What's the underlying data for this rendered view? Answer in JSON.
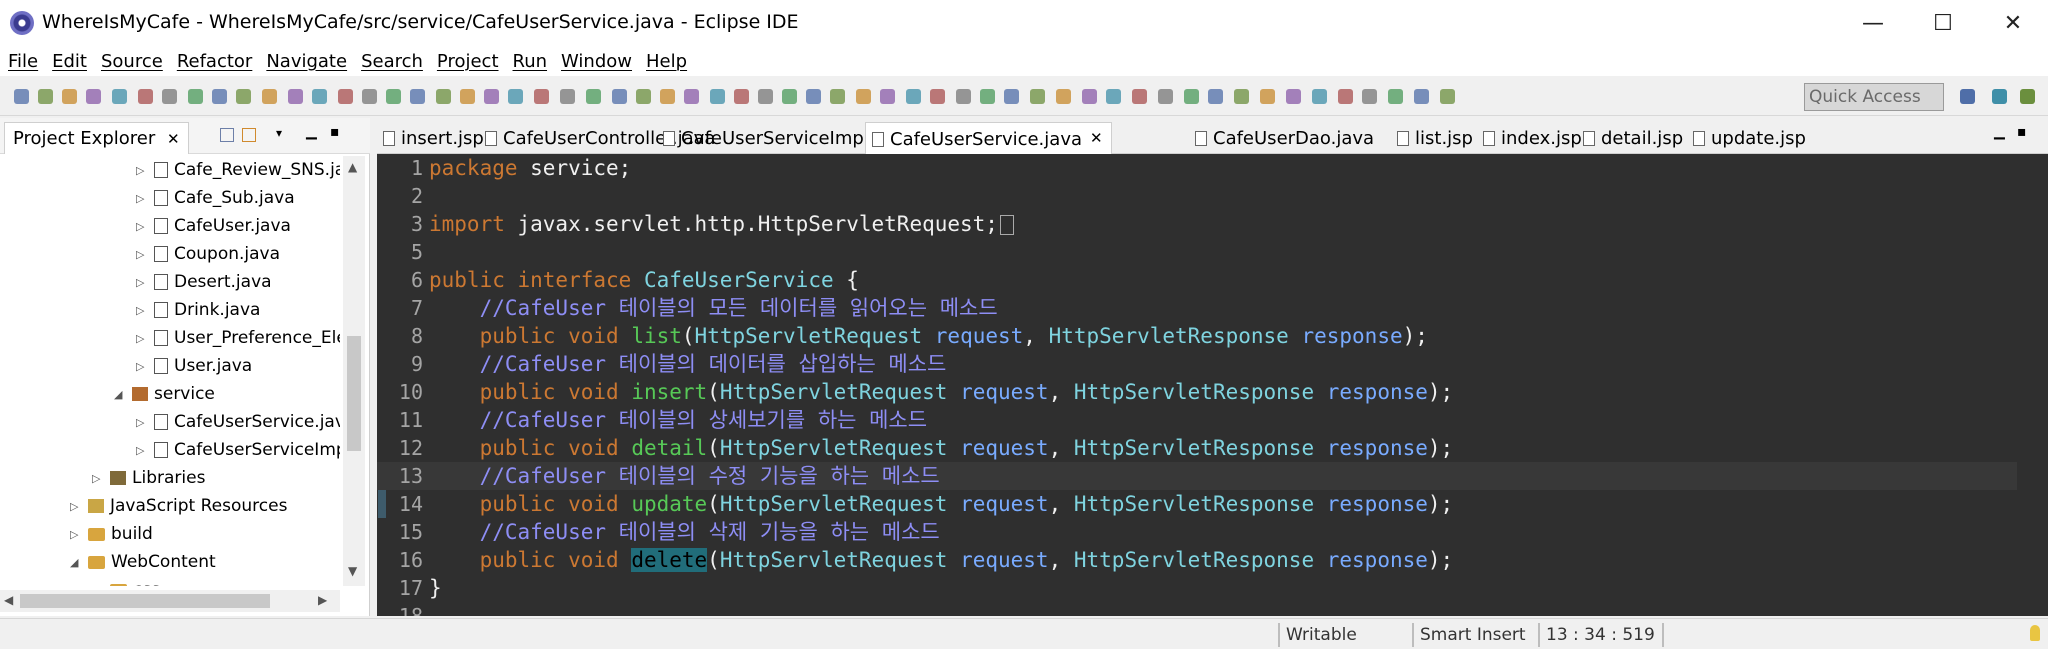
{
  "window": {
    "title": "WhereIsMyCafe - WhereIsMyCafe/src/service/CafeUserService.java - Eclipse IDE",
    "minimize": "—",
    "maximize": "☐",
    "close": "✕"
  },
  "menu": [
    "File",
    "Edit",
    "Source",
    "Refactor",
    "Navigate",
    "Search",
    "Project",
    "Run",
    "Window",
    "Help"
  ],
  "toolbar": {
    "quick_access_placeholder": "Quick Access"
  },
  "explorer": {
    "tab_label": "Project Explorer",
    "tab_close": "✕",
    "items": [
      {
        "label": "Cafe_Review_SNS.java",
        "type": "java",
        "indent": 1,
        "arrow": "▷"
      },
      {
        "label": "Cafe_Sub.java",
        "type": "java",
        "indent": 1,
        "arrow": "▷"
      },
      {
        "label": "CafeUser.java",
        "type": "java",
        "indent": 1,
        "arrow": "▷"
      },
      {
        "label": "Coupon.java",
        "type": "java",
        "indent": 1,
        "arrow": "▷"
      },
      {
        "label": "Desert.java",
        "type": "java",
        "indent": 1,
        "arrow": "▷"
      },
      {
        "label": "Drink.java",
        "type": "java",
        "indent": 1,
        "arrow": "▷"
      },
      {
        "label": "User_Preference_Element.java",
        "type": "java",
        "indent": 1,
        "arrow": "▷"
      },
      {
        "label": "User.java",
        "type": "java",
        "indent": 1,
        "arrow": "▷"
      },
      {
        "label": "service",
        "type": "pkg",
        "indent": 0,
        "arrow": "◢"
      },
      {
        "label": "CafeUserService.java",
        "type": "java",
        "indent": 1,
        "arrow": "▷"
      },
      {
        "label": "CafeUserServiceImpl.java",
        "type": "java",
        "indent": 1,
        "arrow": "▷"
      },
      {
        "label": "Libraries",
        "type": "lib",
        "indent": -1,
        "arrow": "▷"
      },
      {
        "label": "JavaScript Resources",
        "type": "js",
        "indent": -2,
        "arrow": "▷"
      },
      {
        "label": "build",
        "type": "folder",
        "indent": -2,
        "arrow": "▷"
      },
      {
        "label": "WebContent",
        "type": "folder",
        "indent": -2,
        "arrow": "◢"
      },
      {
        "label": "css",
        "type": "folder",
        "indent": -1,
        "arrow": "▷"
      }
    ]
  },
  "editor": {
    "tabs": [
      {
        "label": "insert.jsp",
        "active": false
      },
      {
        "label": "CafeUserController.java",
        "active": false
      },
      {
        "label": "CafeUserServiceImpl.java",
        "active": false
      },
      {
        "label": "CafeUserService.java",
        "active": true,
        "close": "✕"
      },
      {
        "label": "CafeUserDao.java",
        "active": false
      },
      {
        "label": "list.jsp",
        "active": false
      },
      {
        "label": "index.jsp",
        "active": false
      },
      {
        "label": "detail.jsp",
        "active": false
      },
      {
        "label": "update.jsp",
        "active": false
      }
    ],
    "lines": [
      {
        "n": "1",
        "tokens": [
          [
            "kw",
            "package"
          ],
          [
            "plain",
            " service;"
          ]
        ]
      },
      {
        "n": "2",
        "tokens": []
      },
      {
        "n": "3",
        "tokens": [
          [
            "kw",
            "import"
          ],
          [
            "plain",
            " javax.servlet.http.HttpServletRequest;"
          ]
        ],
        "fold": true
      },
      {
        "n": "5",
        "tokens": []
      },
      {
        "n": "6",
        "tokens": [
          [
            "kw",
            "public interface"
          ],
          [
            "plain",
            " "
          ],
          [
            "cls",
            "CafeUserService"
          ],
          [
            "plain",
            " {"
          ]
        ]
      },
      {
        "n": "7",
        "tokens": [
          [
            "plain",
            "    "
          ],
          [
            "cmt",
            "//CafeUser 테이블의 모든 데이터를 읽어오는 메소드"
          ]
        ]
      },
      {
        "n": "8",
        "tokens": [
          [
            "plain",
            "    "
          ],
          [
            "kw",
            "public void"
          ],
          [
            "plain",
            " "
          ],
          [
            "meth",
            "list"
          ],
          [
            "plain",
            "("
          ],
          [
            "cls",
            "HttpServletRequest"
          ],
          [
            "plain",
            " "
          ],
          [
            "var",
            "request"
          ],
          [
            "plain",
            ", "
          ],
          [
            "cls",
            "HttpServletResponse"
          ],
          [
            "plain",
            " "
          ],
          [
            "var",
            "response"
          ],
          [
            "plain",
            ");"
          ]
        ]
      },
      {
        "n": "9",
        "tokens": [
          [
            "plain",
            "    "
          ],
          [
            "cmt",
            "//CafeUser 테이블의 데이터를 삽입하는 메소드"
          ]
        ]
      },
      {
        "n": "10",
        "tokens": [
          [
            "plain",
            "    "
          ],
          [
            "kw",
            "public void"
          ],
          [
            "plain",
            " "
          ],
          [
            "meth",
            "insert"
          ],
          [
            "plain",
            "("
          ],
          [
            "cls",
            "HttpServletRequest"
          ],
          [
            "plain",
            " "
          ],
          [
            "var",
            "request"
          ],
          [
            "plain",
            ", "
          ],
          [
            "cls",
            "HttpServletResponse"
          ],
          [
            "plain",
            " "
          ],
          [
            "var",
            "response"
          ],
          [
            "plain",
            ");"
          ]
        ]
      },
      {
        "n": "11",
        "tokens": [
          [
            "plain",
            "    "
          ],
          [
            "cmt",
            "//CafeUser 테이블의 상세보기를 하는 메소드"
          ]
        ]
      },
      {
        "n": "12",
        "tokens": [
          [
            "plain",
            "    "
          ],
          [
            "kw",
            "public void"
          ],
          [
            "plain",
            " "
          ],
          [
            "meth",
            "detail"
          ],
          [
            "plain",
            "("
          ],
          [
            "cls",
            "HttpServletRequest"
          ],
          [
            "plain",
            " "
          ],
          [
            "var",
            "request"
          ],
          [
            "plain",
            ", "
          ],
          [
            "cls",
            "HttpServletResponse"
          ],
          [
            "plain",
            " "
          ],
          [
            "var",
            "response"
          ],
          [
            "plain",
            ");"
          ]
        ]
      },
      {
        "n": "13",
        "tokens": [
          [
            "plain",
            "    "
          ],
          [
            "cmt",
            "//CafeUser 테이블의 수정 기능을 하는 메소드"
          ]
        ],
        "current": true
      },
      {
        "n": "14",
        "tokens": [
          [
            "plain",
            "    "
          ],
          [
            "kw",
            "public void"
          ],
          [
            "plain",
            " "
          ],
          [
            "meth",
            "update"
          ],
          [
            "plain",
            "("
          ],
          [
            "cls",
            "HttpServletRequest"
          ],
          [
            "plain",
            " "
          ],
          [
            "var",
            "request"
          ],
          [
            "plain",
            ", "
          ],
          [
            "cls",
            "HttpServletResponse"
          ],
          [
            "plain",
            " "
          ],
          [
            "var",
            "response"
          ],
          [
            "plain",
            ");"
          ]
        ]
      },
      {
        "n": "15",
        "tokens": [
          [
            "plain",
            "    "
          ],
          [
            "cmt",
            "//CafeUser 테이블의 삭제 기능을 하는 메소드"
          ]
        ]
      },
      {
        "n": "16",
        "tokens": [
          [
            "plain",
            "    "
          ],
          [
            "kw",
            "public void"
          ],
          [
            "plain",
            " "
          ],
          [
            "sel",
            "delete"
          ],
          [
            "plain",
            "("
          ],
          [
            "cls",
            "HttpServletRequest"
          ],
          [
            "plain",
            " "
          ],
          [
            "var",
            "request"
          ],
          [
            "plain",
            ", "
          ],
          [
            "cls",
            "HttpServletResponse"
          ],
          [
            "plain",
            " "
          ],
          [
            "var",
            "response"
          ],
          [
            "plain",
            ");"
          ]
        ]
      },
      {
        "n": "17",
        "tokens": [
          [
            "plain",
            "}"
          ]
        ]
      },
      {
        "n": "18",
        "tokens": []
      }
    ]
  },
  "status": {
    "writable": "Writable",
    "insert_mode": "Smart Insert",
    "position": "13 : 34 : 519"
  },
  "colors": {
    "editor_bg": "#2f2f2f",
    "keyword": "#cc7832",
    "class": "#7fd4e0",
    "method": "#57c957",
    "comment": "#8e8ef5"
  }
}
